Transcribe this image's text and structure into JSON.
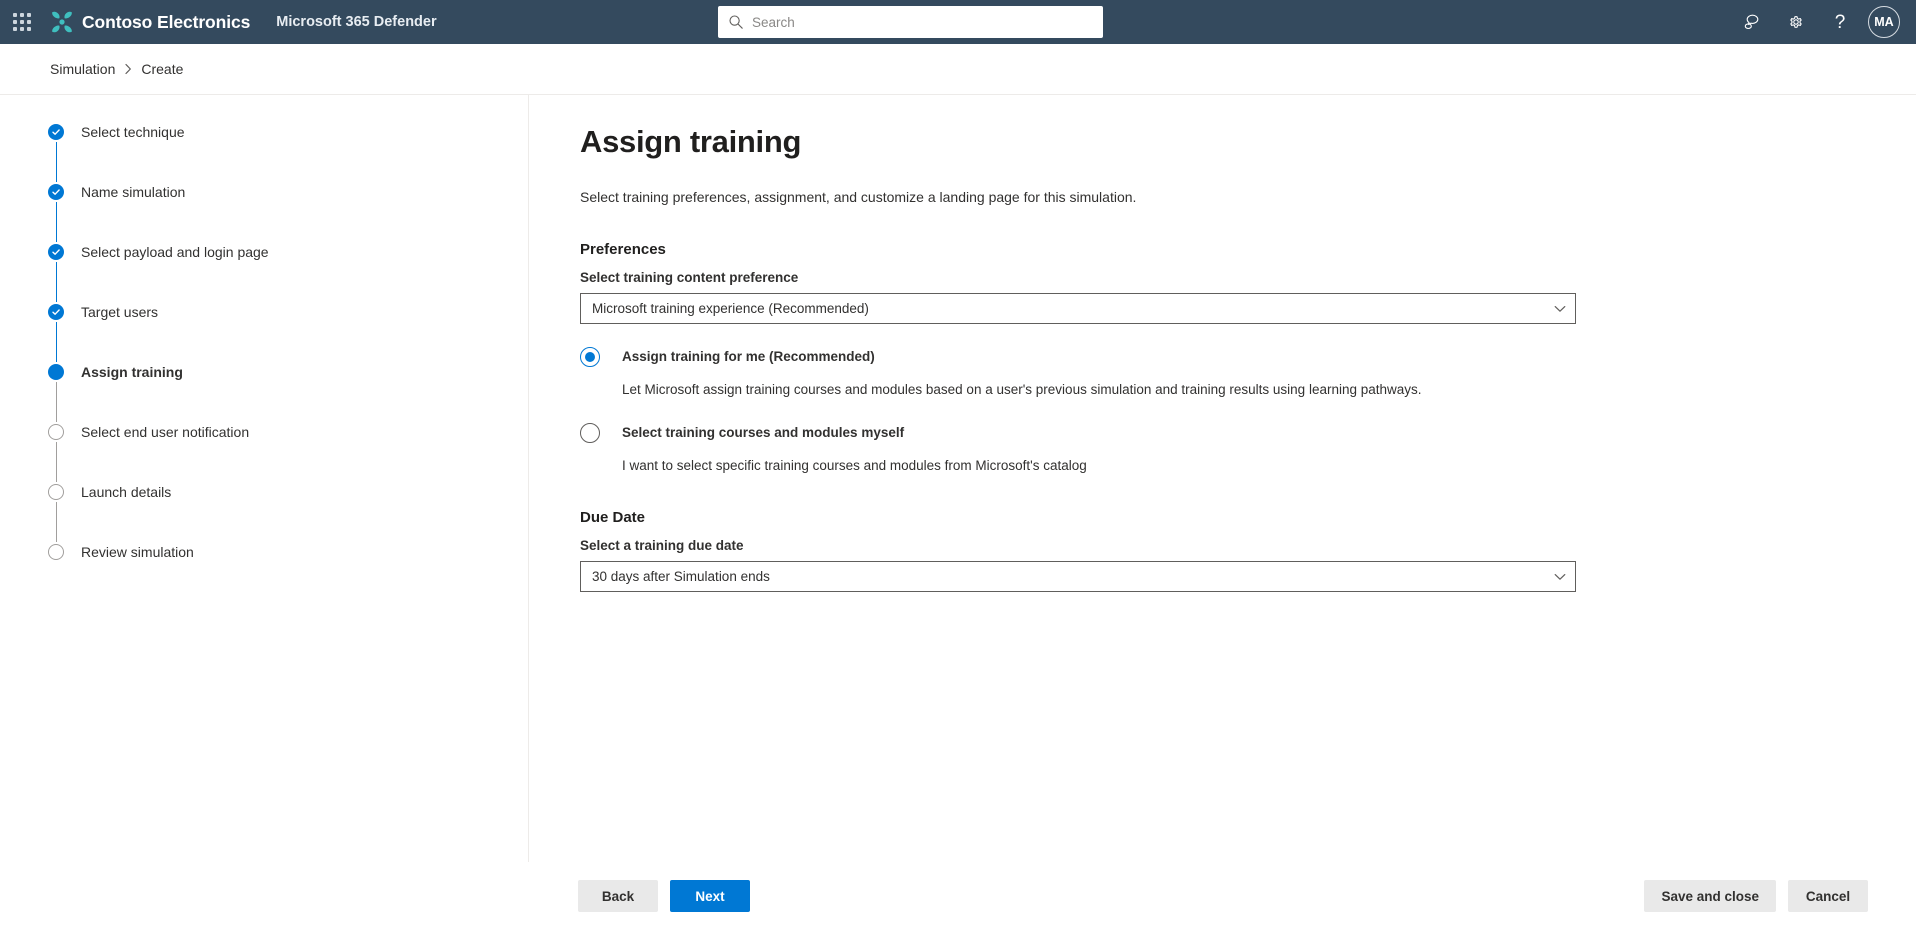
{
  "topbar": {
    "waffle_label": "App launcher",
    "brand": "Contoso Electronics",
    "app_name": "Microsoft 365 Defender",
    "search": {
      "placeholder": "Search",
      "value": ""
    },
    "icons": {
      "feedback": "feedback-icon",
      "settings": "gear-icon",
      "help": "?"
    },
    "avatar_initials": "MA"
  },
  "breadcrumb": {
    "items": [
      {
        "label": "Simulation"
      },
      {
        "label": "Create"
      }
    ],
    "separator": "›"
  },
  "wizard": {
    "steps": [
      {
        "label": "Select technique",
        "state": "done"
      },
      {
        "label": "Name simulation",
        "state": "done"
      },
      {
        "label": "Select payload and login page",
        "state": "done"
      },
      {
        "label": "Target users",
        "state": "done"
      },
      {
        "label": "Assign training",
        "state": "current"
      },
      {
        "label": "Select end user notification",
        "state": "todo"
      },
      {
        "label": "Launch details",
        "state": "todo"
      },
      {
        "label": "Review simulation",
        "state": "todo"
      }
    ]
  },
  "main": {
    "title": "Assign training",
    "description": "Select training preferences, assignment, and customize a landing page for this simulation.",
    "preferences": {
      "heading": "Preferences",
      "content_pref_label": "Select training content preference",
      "content_pref_value": "Microsoft training experience (Recommended)",
      "options": [
        {
          "title": "Assign training for me (Recommended)",
          "description": "Let Microsoft assign training courses and modules based on a user's previous simulation and training results using learning pathways.",
          "selected": true
        },
        {
          "title": "Select training courses and modules myself",
          "description": "I want to select specific training courses and modules from Microsoft's catalog",
          "selected": false
        }
      ]
    },
    "due_date": {
      "heading": "Due Date",
      "label": "Select a training due date",
      "value": "30 days after Simulation ends"
    }
  },
  "footer": {
    "back_label": "Back",
    "next_label": "Next",
    "save_label": "Save and close",
    "cancel_label": "Cancel"
  },
  "colors": {
    "navbar": "#344a5e",
    "accent": "#0078d4",
    "logo_teal": "#3fbfbf",
    "inactive": "#a19f9d"
  }
}
